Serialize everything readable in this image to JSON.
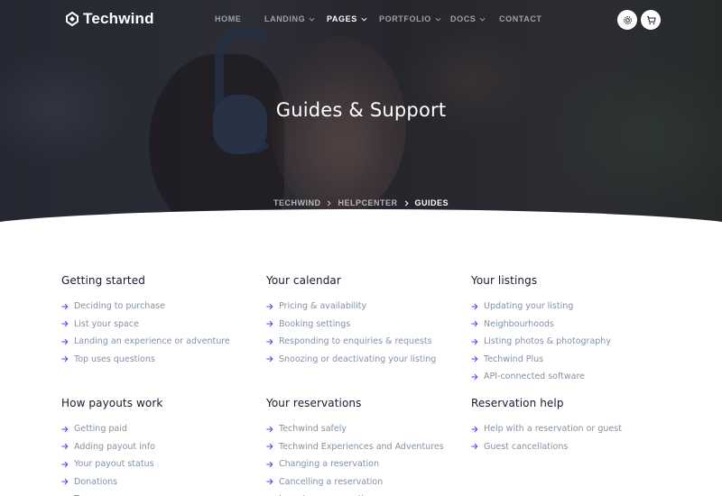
{
  "brand": {
    "name": "Techwind"
  },
  "nav": {
    "items": [
      {
        "label": "HOME",
        "has_dropdown": false,
        "active": false
      },
      {
        "label": "LANDING",
        "has_dropdown": true,
        "active": false
      },
      {
        "label": "PAGES",
        "has_dropdown": true,
        "active": true
      },
      {
        "label": "PORTFOLIO",
        "has_dropdown": true,
        "active": false
      },
      {
        "label": "DOCS",
        "has_dropdown": true,
        "active": false
      },
      {
        "label": "CONTACT",
        "has_dropdown": false,
        "active": false
      }
    ],
    "icons": [
      "gear-icon",
      "cart-icon"
    ]
  },
  "hero": {
    "title": "Guides & Support",
    "breadcrumb": [
      "TECHWIND",
      "HELPCENTER",
      "GUIDES"
    ]
  },
  "sections": [
    {
      "title": "Getting started",
      "links": [
        "Deciding to purchase",
        "List your space",
        "Landing an experience or adventure",
        "Top uses questions"
      ]
    },
    {
      "title": "Your calendar",
      "links": [
        "Pricing & availability",
        "Booking settings",
        "Responding to enquiries & requests",
        "Snoozing or deactivating your listing"
      ]
    },
    {
      "title": "Your listings",
      "links": [
        "Updating your listing",
        "Neighbourhoods",
        "Listing photos & photography",
        "Techwind Plus",
        "API-connected software"
      ]
    },
    {
      "title": "How payouts work",
      "links": [
        "Getting paid",
        "Adding payout info",
        "Your payout status",
        "Donations",
        "Taxes"
      ]
    },
    {
      "title": "Your reservations",
      "links": [
        "Techwind safely",
        "Techwind Experiences and Adventures",
        "Changing a reservation",
        "Cancelling a reservation",
        "Long-term reservations"
      ]
    },
    {
      "title": "Reservation help",
      "links": [
        "Help with a reservation or guest",
        "Guest cancellations"
      ]
    }
  ],
  "colors": {
    "accent": "#4f46e5",
    "heading": "#161c2d",
    "muted": "#8492a6"
  }
}
